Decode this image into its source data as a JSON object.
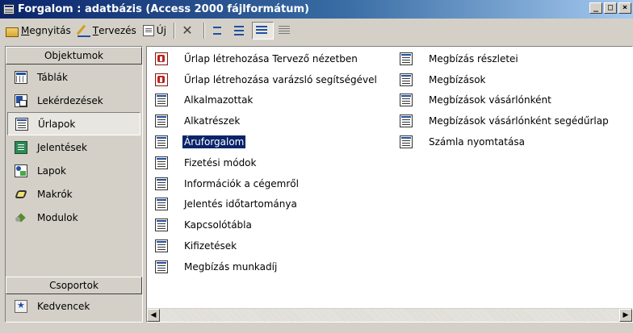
{
  "window": {
    "title": "Forgalom : adatbázis (Access 2000 fájlformátum)",
    "minimize_glyph": "_",
    "maximize_glyph": "□",
    "close_glyph": "×"
  },
  "toolbar": {
    "open_mnemonic": "M",
    "open_rest": "egnyitás",
    "design_mnemonic": "T",
    "design_rest": "ervezés",
    "new_pre": "Ú",
    "new_mnemonic": "j",
    "delete_glyph": "✕"
  },
  "sidebar": {
    "objects_header": "Objektumok",
    "items": [
      {
        "label": "Táblák"
      },
      {
        "label": "Lekérdezések"
      },
      {
        "label": "Űrlapok"
      },
      {
        "label": "Jelentések"
      },
      {
        "label": "Lapok"
      },
      {
        "label": "Makrók"
      },
      {
        "label": "Modulok"
      }
    ],
    "groups_header": "Csoportok",
    "groups": [
      {
        "label": "Kedvencek"
      }
    ],
    "selected": "Űrlapok"
  },
  "list": {
    "column1": [
      {
        "label": "Űrlap létrehozása Tervező nézetben",
        "icon": "design-wizard-icon"
      },
      {
        "label": "Űrlap létrehozása varázsló segítségével",
        "icon": "form-wizard-icon"
      },
      {
        "label": "Alkalmazottak",
        "icon": "form-icon"
      },
      {
        "label": "Alkatrészek",
        "icon": "form-icon"
      },
      {
        "label": "Áruforgalom",
        "icon": "form-icon"
      },
      {
        "label": "Fizetési módok",
        "icon": "form-icon"
      },
      {
        "label": "Információk a cégemről",
        "icon": "form-icon"
      },
      {
        "label": "Jelentés időtartománya",
        "icon": "form-icon"
      },
      {
        "label": "Kapcsolótábla",
        "icon": "form-icon"
      },
      {
        "label": "Kifizetések",
        "icon": "form-icon"
      },
      {
        "label": "Megbízás munkadíj",
        "icon": "form-icon"
      }
    ],
    "column2": [
      {
        "label": "Megbízás részletei",
        "icon": "form-icon"
      },
      {
        "label": "Megbízások",
        "icon": "form-icon"
      },
      {
        "label": "Megbízások vásárlónként",
        "icon": "form-icon"
      },
      {
        "label": "Megbízások vásárlónként segédűrlap",
        "icon": "form-icon"
      },
      {
        "label": "Számla nyomtatása",
        "icon": "form-icon"
      }
    ],
    "selected": "Áruforgalom",
    "scroll_left_glyph": "◀",
    "scroll_right_glyph": "▶"
  }
}
